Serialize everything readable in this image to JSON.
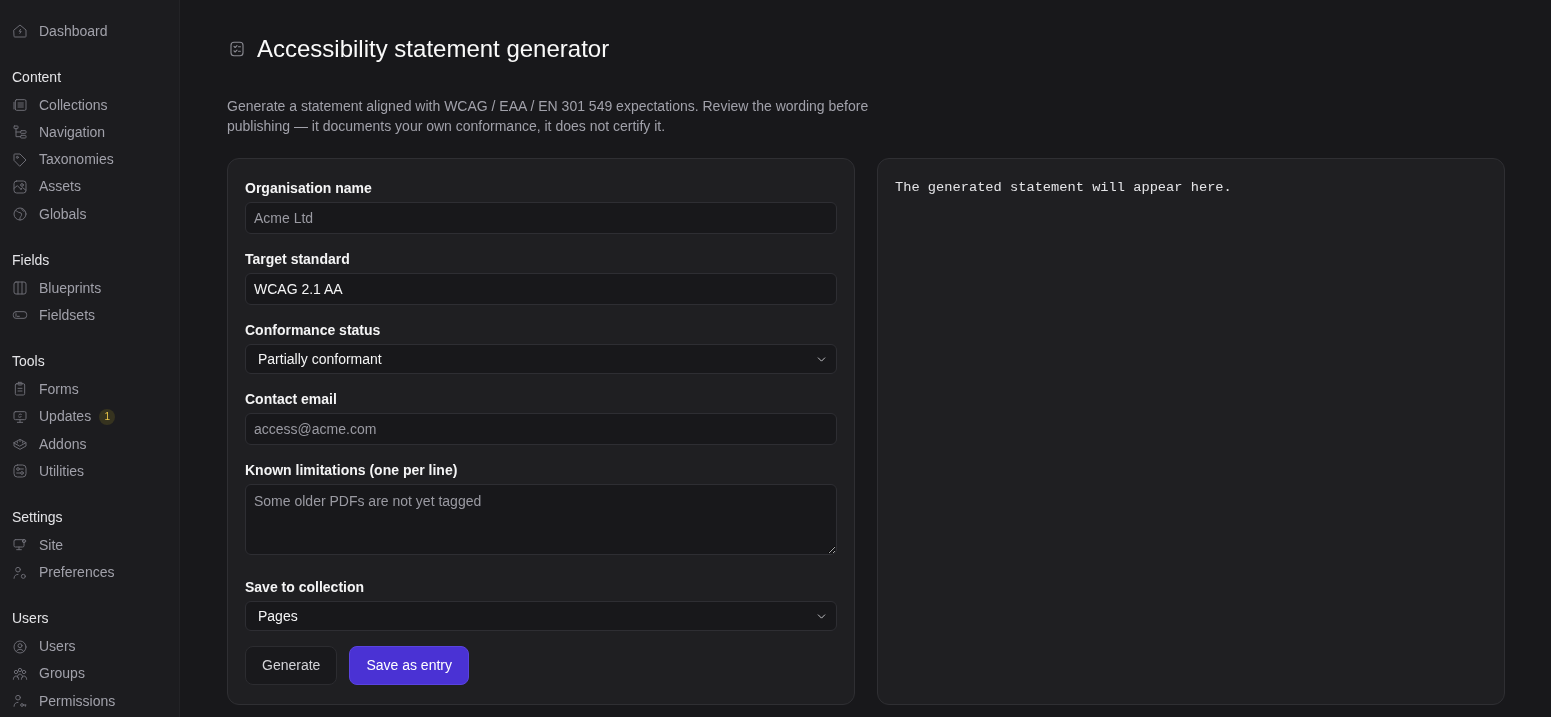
{
  "sidebar": {
    "sections": [
      {
        "items": [
          {
            "label": "Dashboard",
            "selected": false
          }
        ]
      },
      {
        "heading": "Content",
        "items": [
          {
            "label": "Collections",
            "selected": false
          },
          {
            "label": "Navigation",
            "selected": false
          },
          {
            "label": "Taxonomies",
            "selected": false
          },
          {
            "label": "Assets",
            "selected": false
          },
          {
            "label": "Globals",
            "selected": false
          }
        ]
      },
      {
        "heading": "Fields",
        "items": [
          {
            "label": "Blueprints",
            "selected": false
          },
          {
            "label": "Fieldsets",
            "selected": false
          }
        ]
      },
      {
        "heading": "Tools",
        "items": [
          {
            "label": "Forms",
            "selected": false
          },
          {
            "label": "Updates",
            "selected": false,
            "badge": "1"
          },
          {
            "label": "Addons",
            "selected": false
          },
          {
            "label": "Utilities",
            "selected": false
          }
        ]
      },
      {
        "heading": "Settings",
        "items": [
          {
            "label": "Site",
            "selected": false
          },
          {
            "label": "Preferences",
            "selected": false
          }
        ]
      },
      {
        "heading": "Users",
        "items": [
          {
            "label": "Users",
            "selected": false
          },
          {
            "label": "Groups",
            "selected": false
          },
          {
            "label": "Permissions",
            "selected": false
          }
        ]
      }
    ]
  },
  "page": {
    "title": "Accessibility statement generator",
    "description": "Generate a statement aligned with WCAG / EAA / EN 301 549 expectations. Review the wording before publishing — it documents your own conformance, it does not certify it."
  },
  "form": {
    "fields": [
      {
        "kind": "input",
        "label": "Organisation name",
        "placeholder": "Acme Ltd"
      },
      {
        "kind": "input",
        "label": "Target standard",
        "value": "WCAG 2.1 AA"
      },
      {
        "kind": "select",
        "label": "Conformance status",
        "value": "Partially conformant"
      },
      {
        "kind": "input",
        "label": "Contact email",
        "placeholder": "access@acme.com"
      },
      {
        "kind": "textarea",
        "label": "Known limitations (one per line)",
        "placeholder": "Some older PDFs are not yet tagged"
      },
      {
        "kind": "select",
        "label": "Save to collection",
        "value": "Pages"
      }
    ],
    "buttons": [
      {
        "label": "Generate",
        "kind": "secondary"
      },
      {
        "label": "Save as entry",
        "kind": "primary"
      }
    ]
  },
  "preview": {
    "text": "The generated statement will appear here."
  }
}
